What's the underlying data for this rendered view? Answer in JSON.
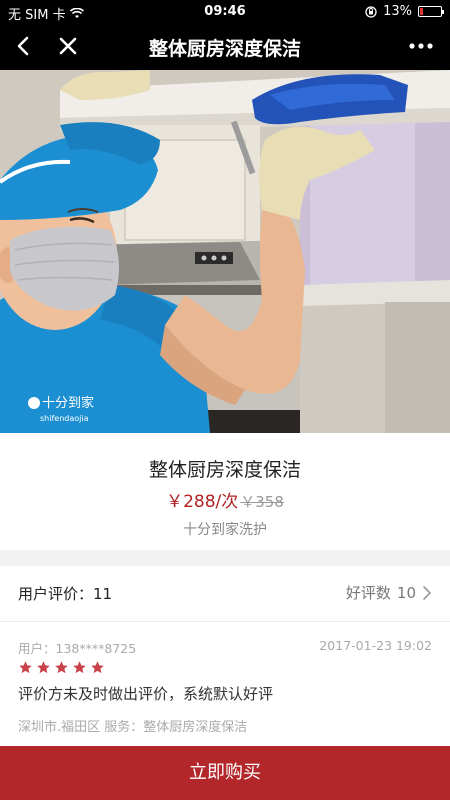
{
  "status_bar": {
    "carrier": "无 SIM 卡",
    "time": "09:46",
    "battery": "13%",
    "battery_level": 0.13,
    "battery_color": "#e33333"
  },
  "nav": {
    "title": "整体厨房深度保洁",
    "back_icon": "chevron-left",
    "close_icon": "close-x",
    "more_icon": "ellipsis"
  },
  "product": {
    "title": "整体厨房深度保洁",
    "price": "￥288/次",
    "original_price": "￥358",
    "brand": "十分到家洗护",
    "price_color": "#b22222"
  },
  "reviews": {
    "label": "用户评价：",
    "count": "11",
    "good_label": "好评数",
    "good_count": "10",
    "items": [
      {
        "user": "用户：138****8725",
        "date": "2017-01-23 19:02",
        "stars": 5,
        "text": "评价方未及时做出评价，系统默认好评",
        "location": "深圳市.福田区",
        "service_label": "服务：",
        "service": "整体厨房深度保洁"
      }
    ]
  },
  "buy": {
    "label": "立即购买",
    "color": "#b3262a"
  },
  "hero": {
    "logo_text": "十分到家",
    "logo_sub": "shifendaojia"
  }
}
